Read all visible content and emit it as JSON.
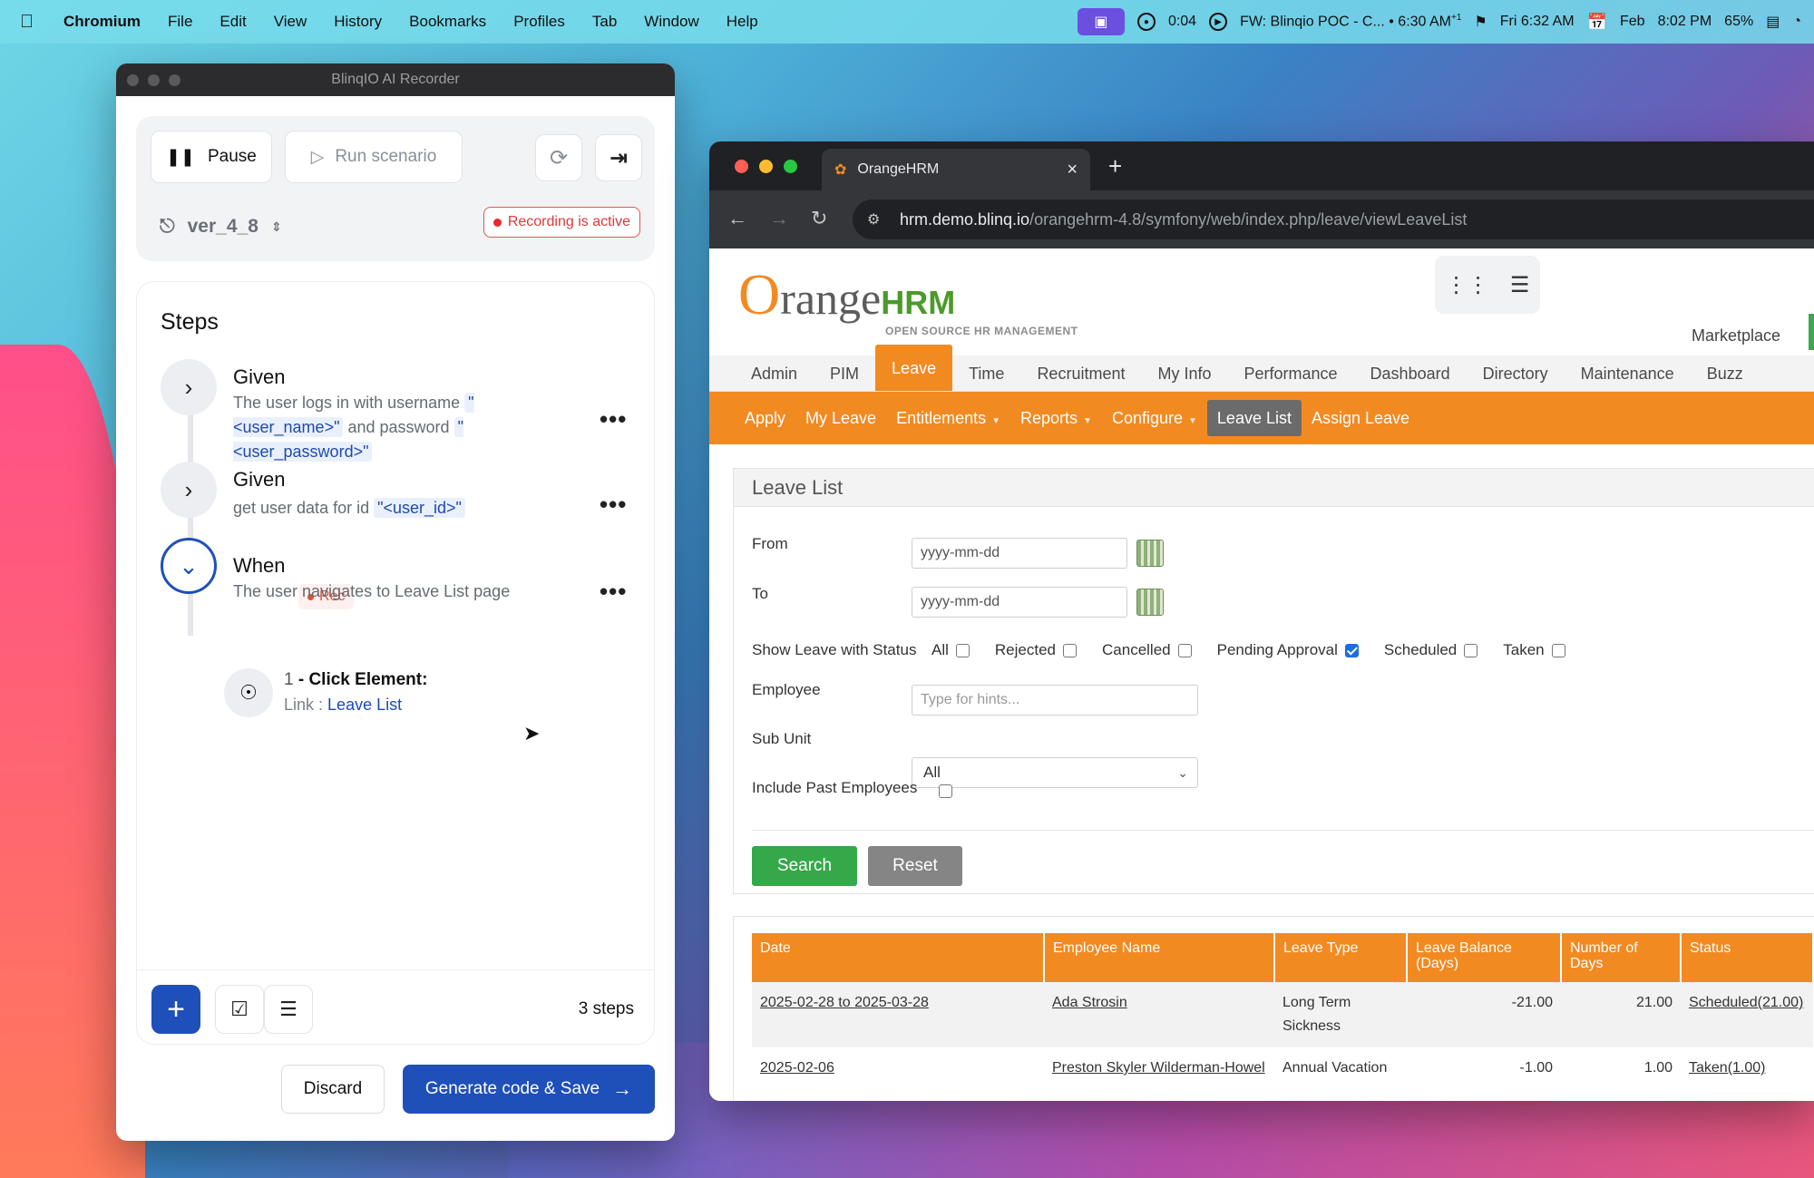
{
  "menubar": {
    "app": "Chromium",
    "items": [
      "File",
      "Edit",
      "View",
      "History",
      "Bookmarks",
      "Profiles",
      "Tab",
      "Window",
      "Help"
    ],
    "timer": "0:04",
    "meeting": "FW: Blinqio POC - C... • 6:30 AM",
    "meeting_sup": "+1",
    "clock1": "Fri 6:32 AM",
    "date": "Feb",
    "clock2": "8:02 PM",
    "battery": "65%"
  },
  "recorder": {
    "title": "BlinqIO AI Recorder",
    "pause_label": "Pause",
    "run_label": "Run scenario",
    "version": "ver_4_8",
    "recording_badge": "Recording is active",
    "steps_title": "Steps",
    "steps": [
      {
        "keyword": "Given",
        "text_a": "The user logs in with username",
        "param_a": "\"<user_name>\"",
        "text_b": "and password",
        "param_b": "\"<user_password>\""
      },
      {
        "keyword": "Given",
        "text_a": "get user data for id",
        "param_a": "\"<user_id>\""
      },
      {
        "keyword": "When",
        "tag": "Rec",
        "text_a": "The user navigates to Leave List page"
      }
    ],
    "action": {
      "number": "1",
      "title": "- Click Element:",
      "sub_label": "Link :",
      "sub_link": "Leave List"
    },
    "steps_count": "3 steps",
    "discard_label": "Discard",
    "generate_label": "Generate code & Save"
  },
  "browser": {
    "tab_title": "OrangeHRM",
    "url_host": "hrm.demo.blinq.io",
    "url_path": "/orangehrm-4.8/symfony/web/index.php/leave/viewLeaveList"
  },
  "hrm": {
    "logo_o": "O",
    "logo_word": "range",
    "logo_hrm": "HRM",
    "logo_tagline": "OPEN SOURCE HR MANAGEMENT",
    "marketplace": "Marketplace",
    "main_nav": [
      "Admin",
      "PIM",
      "Leave",
      "Time",
      "Recruitment",
      "My Info",
      "Performance",
      "Dashboard",
      "Directory",
      "Maintenance",
      "Buzz"
    ],
    "sub_nav": [
      "Apply",
      "My Leave",
      "Entitlements",
      "Reports",
      "Configure",
      "Leave List",
      "Assign Leave"
    ],
    "filter": {
      "title": "Leave List",
      "from_label": "From",
      "from_value": "yyyy-mm-dd",
      "to_label": "To",
      "to_value": "yyyy-mm-dd",
      "status_label": "Show Leave with Status",
      "statuses": [
        "All",
        "Rejected",
        "Cancelled",
        "Pending Approval",
        "Scheduled",
        "Taken"
      ],
      "employee_label": "Employee",
      "employee_placeholder": "Type for hints...",
      "subunit_label": "Sub Unit",
      "subunit_value": "All",
      "past_label": "Include Past Employees",
      "search_label": "Search",
      "reset_label": "Reset"
    },
    "table": {
      "headers": [
        "Date",
        "Employee Name",
        "Leave Type",
        "Leave Balance (Days)",
        "Number of Days",
        "Status"
      ],
      "rows": [
        [
          "2025-02-28 to 2025-03-28",
          "Ada Strosin",
          "Long Term Sickness",
          "-21.00",
          "21.00",
          "Scheduled(21.00)"
        ],
        [
          "2025-02-06",
          "Preston Skyler Wilderman-Howel",
          "Annual Vacation",
          "-1.00",
          "1.00",
          "Taken(1.00)"
        ]
      ]
    }
  }
}
